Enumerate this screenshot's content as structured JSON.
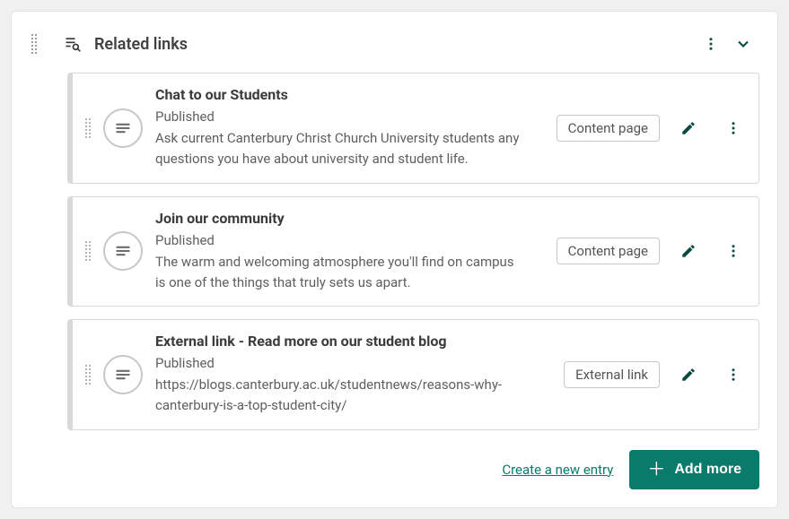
{
  "panel": {
    "title": "Related links"
  },
  "entries": [
    {
      "title": "Chat to our Students",
      "status": "Published",
      "description": "Ask current Canterbury Christ Church University students any questions you have about university and student life.",
      "badge": "Content page"
    },
    {
      "title": "Join our community",
      "status": "Published",
      "description": "The warm and welcoming atmosphere you'll find on campus is one of the things that truly sets us apart.",
      "badge": "Content page"
    },
    {
      "title": "External link - Read more on our student blog",
      "status": "Published",
      "description": "https://blogs.canterbury.ac.uk/studentnews/reasons-why-canterbury-is-a-top-student-city/",
      "badge": "External link"
    }
  ],
  "footer": {
    "create_link": "Create a new entry",
    "add_more": "Add more"
  }
}
